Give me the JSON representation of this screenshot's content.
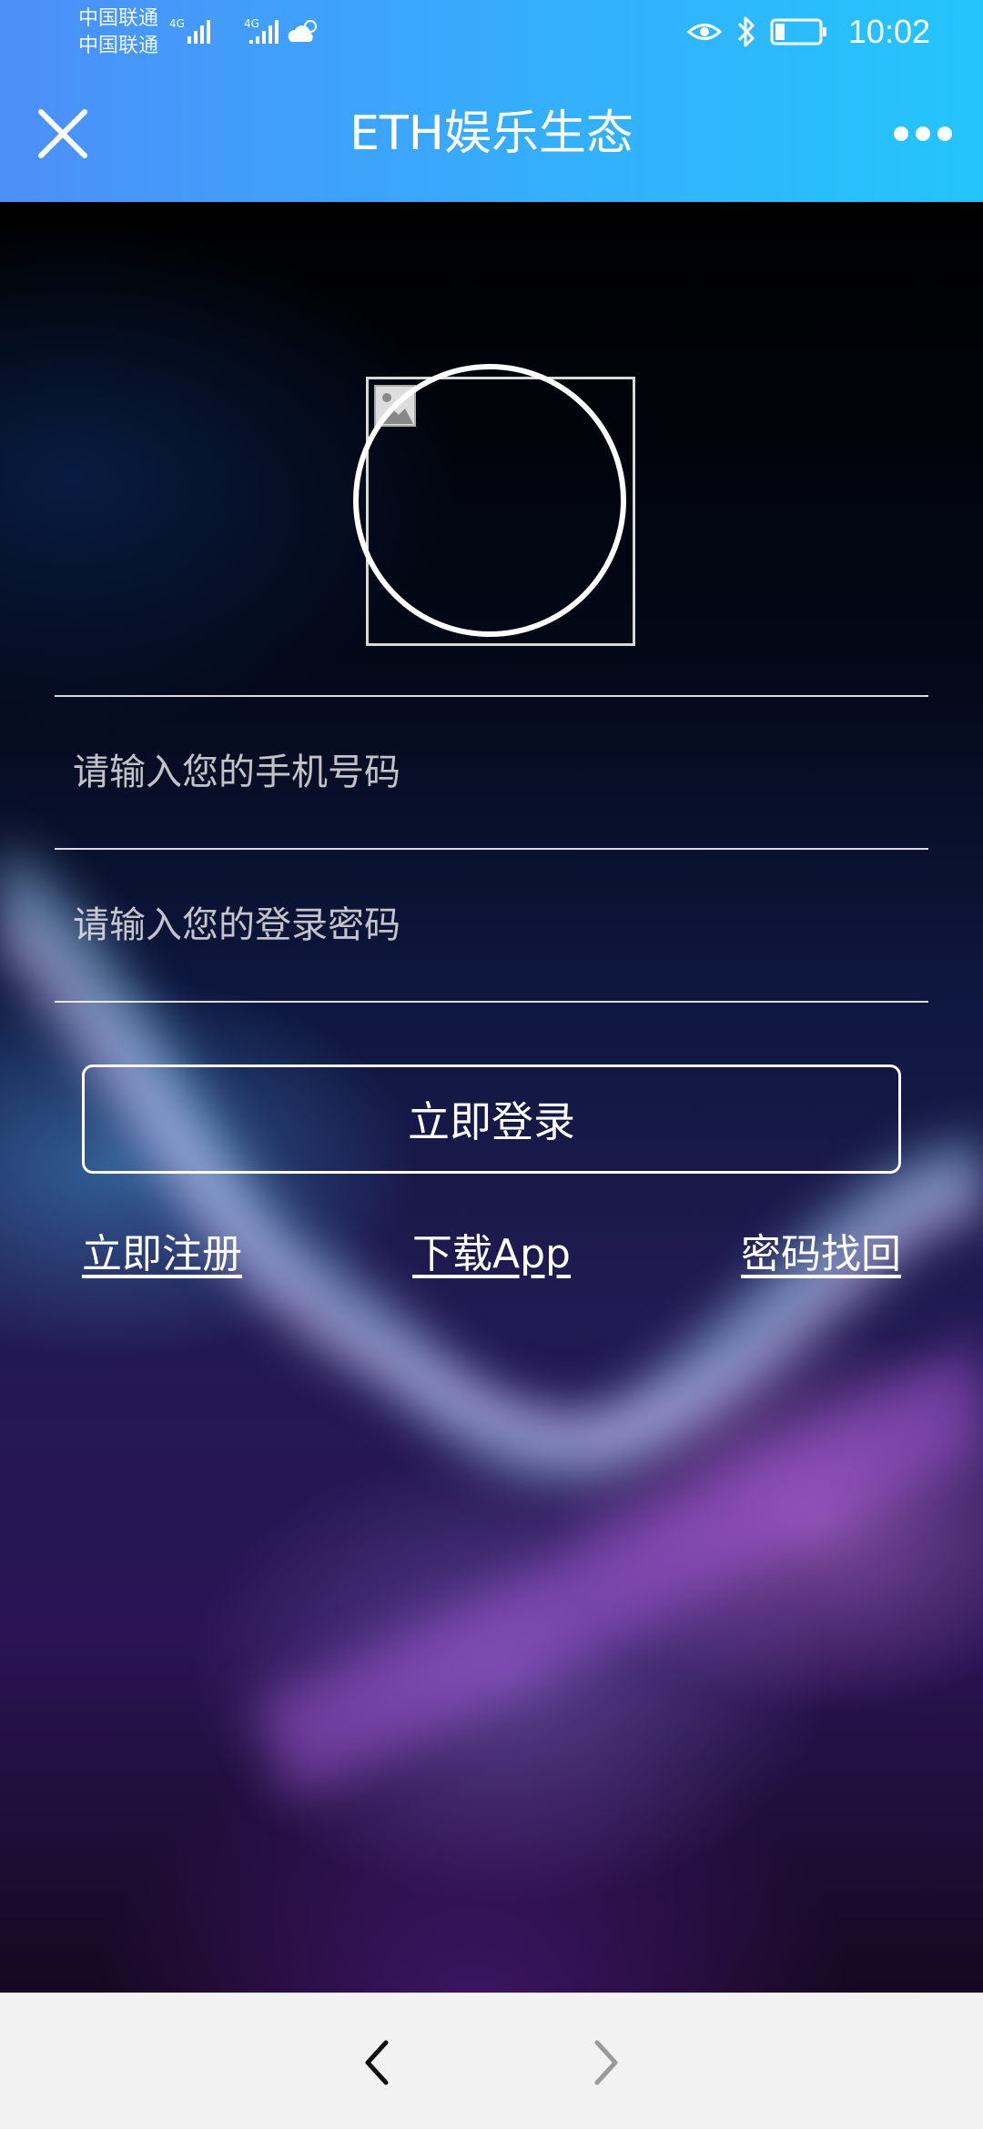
{
  "status_bar": {
    "carrier_1": "中国联通",
    "carrier_2": "中国联通",
    "network_1": "4G",
    "network_2": "4G",
    "time": "10:02",
    "icons": [
      "signal-icon",
      "signal-icon",
      "weather-cloud-icon",
      "eye-icon",
      "bluetooth-icon",
      "battery-icon"
    ],
    "battery_level": 0.2
  },
  "header": {
    "title": "ETH娱乐生态",
    "close_icon": "close-icon",
    "more_icon": "more-dots-icon"
  },
  "logo": {
    "broken_image_icon": "broken-image-icon"
  },
  "form": {
    "phone_placeholder": "请输入您的手机号码",
    "phone_value": "",
    "password_placeholder": "请输入您的登录密码",
    "password_value": "",
    "login_label": "立即登录"
  },
  "links": {
    "register": "立即注册",
    "download": "下载App",
    "recover": "密码找回"
  },
  "bottom_nav": {
    "back_icon": "chevron-left-icon",
    "forward_icon": "chevron-right-icon",
    "forward_enabled": false
  },
  "colors": {
    "header_gradient_start": "#4d8ff9",
    "header_gradient_end": "#24c5fd",
    "nav_background": "#f2f2f2"
  }
}
